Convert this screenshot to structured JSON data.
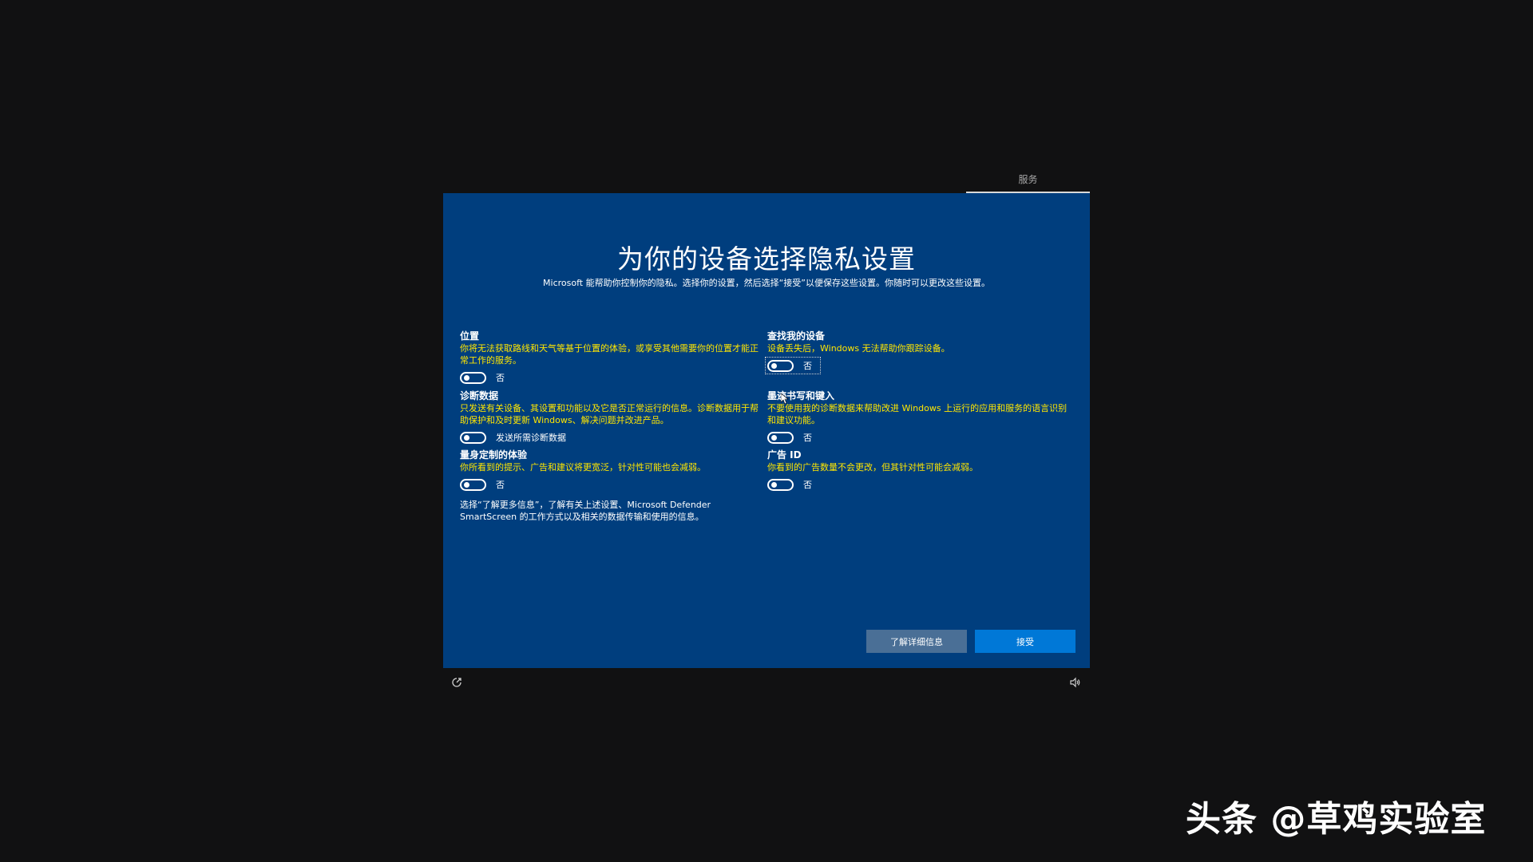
{
  "top_tab": {
    "label": "服务"
  },
  "header": {
    "title": "为你的设备选择隐私设置",
    "subtitle": "Microsoft 能帮助你控制你的隐私。选择你的设置，然后选择“接受”以便保存这些设置。你随时可以更改这些设置。"
  },
  "settings": {
    "location": {
      "title": "位置",
      "desc": "你将无法获取路线和天气等基于位置的体验，或享受其他需要你的位置才能正常工作的服务。",
      "state": "否"
    },
    "find_device": {
      "title": "查找我的设备",
      "desc": "设备丢失后，Windows 无法帮助你跟踪设备。",
      "state": "否"
    },
    "diagnostics": {
      "title": "诊断数据",
      "desc": "只发送有关设备、其设置和功能以及它是否正常运行的信息。诊断数据用于帮助保护和及时更新 Windows、解决问题并改进产品。",
      "state": "发送所需诊断数据"
    },
    "inking": {
      "title": "墨迹书写和键入",
      "desc": "不要使用我的诊断数据来帮助改进 Windows 上运行的应用和服务的语言识别和建议功能。",
      "state": "否"
    },
    "tailored": {
      "title": "量身定制的体验",
      "desc": "你所看到的提示、广告和建议将更宽泛，针对性可能也会减弱。",
      "state": "否"
    },
    "ad_id": {
      "title": "广告 ID",
      "desc": "你看到的广告数量不会更改，但其针对性可能会减弱。",
      "state": "否"
    }
  },
  "info_text": "选择“了解更多信息”，了解有关上述设置、Microsoft Defender SmartScreen 的工作方式以及相关的数据传输和使用的信息。",
  "buttons": {
    "learn_more": "了解详细信息",
    "accept": "接受"
  },
  "watermark": "头条 @草鸡实验室",
  "colors": {
    "panel": "#003e7e",
    "accent": "#0078d7",
    "desc_text": "#ffe600"
  },
  "icons": {
    "bottom_left": "ease-of-access-icon",
    "bottom_right": "volume-icon"
  }
}
